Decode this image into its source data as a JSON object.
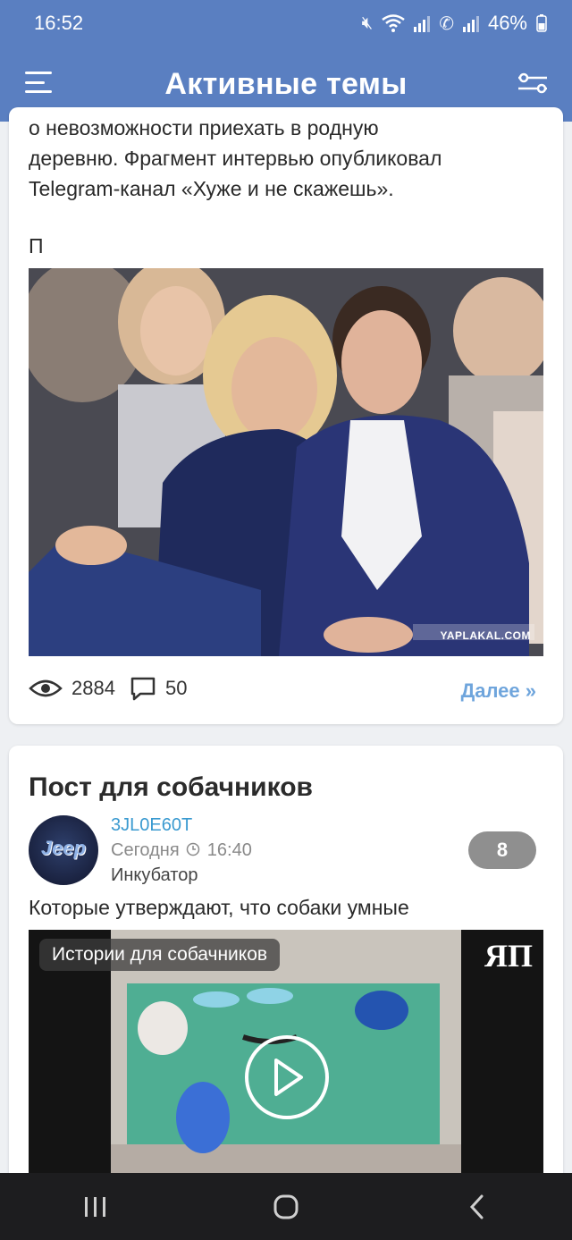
{
  "status_bar": {
    "time": "16:52",
    "battery": "46%"
  },
  "app_bar": {
    "title": "Активные темы"
  },
  "post1": {
    "text_lines": [
      "о невозможности приехать в родную",
      "деревню. Фрагмент интервью опубликовал",
      "Telegram-канал «Хуже и не скажешь»."
    ],
    "trailing_char": "П",
    "image_watermark": "YAPLAKAL.COM",
    "views": "2884",
    "comments": "50",
    "more_label": "Далее »"
  },
  "post2": {
    "title": "Пост для собачников",
    "author": "3JL0E60T",
    "date_label": "Сегодня",
    "time": "16:40",
    "section": "Инкубатор",
    "badge": "8",
    "text": "Которые утверждают, что собаки умные",
    "video_caption": "Истории для собачников",
    "video_logo": "ЯП",
    "avatar_text": "Jeep"
  },
  "icons": {
    "menu": "hamburger-icon",
    "filter": "filter-icon",
    "views": "eye-icon",
    "comments": "comment-icon",
    "clock": "clock-icon",
    "play": "play-icon"
  },
  "colors": {
    "header": "#5a7fc1",
    "link": "#6fa5dc",
    "author": "#3a9ad0",
    "badge": "#8f8f8f"
  }
}
